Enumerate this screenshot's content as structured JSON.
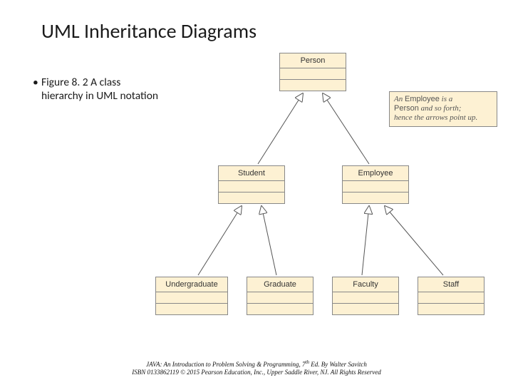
{
  "title": "UML Inheritance Diagrams",
  "bullet": "Figure 8. 2 A class hierarchy in UML notation",
  "callout": {
    "line1_prefix": "An ",
    "line1_em1": "Employee",
    "line1_mid": " is a",
    "line2_em": "Person",
    "line2_rest": " and so forth;",
    "line3": "hence the arrows point up."
  },
  "boxes": {
    "person": "Person",
    "student": "Student",
    "employee": "Employee",
    "undergraduate": "Undergraduate",
    "graduate": "Graduate",
    "faculty": "Faculty",
    "staff": "Staff"
  },
  "footer": {
    "line1a": "JAVA: An Introduction to Problem Solving & Programming, 7",
    "line1sup": "th",
    "line1b": " Ed. By Walter Savitch",
    "line2": "ISBN 0133862119 © 2015 Pearson Education, Inc., Upper Saddle River, NJ. All Rights Reserved"
  }
}
